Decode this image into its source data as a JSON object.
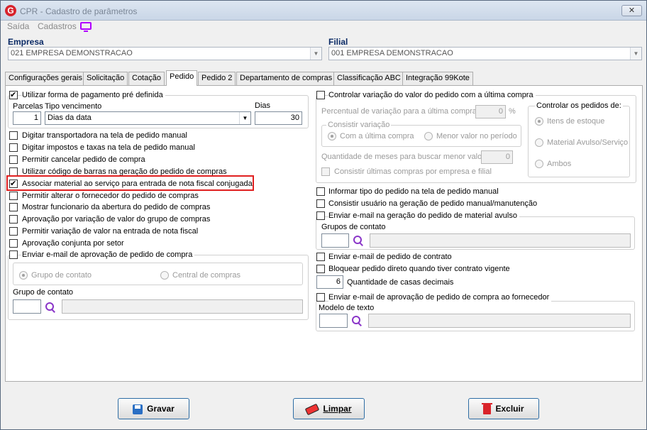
{
  "window": {
    "title": "CPR - Cadastro de parâmetros",
    "close_glyph": "✕",
    "logo_letter": "G"
  },
  "menu": {
    "items": [
      "Saída",
      "Cadastros"
    ],
    "icon": "monitor-icon"
  },
  "empresa": {
    "label": "Empresa",
    "value": "021 EMPRESA DEMONSTRACAO"
  },
  "filial": {
    "label": "Filial",
    "value": "001 EMPRESA DEMONSTRACAO"
  },
  "tabs": [
    "Configurações gerais",
    "Solicitação",
    "Cotação",
    "Pedido",
    "Pedido 2",
    "Departamento de compras",
    "Classificação ABC",
    "Integração 99Kote"
  ],
  "active_tab": "Pedido",
  "left": {
    "pagamento": {
      "label": "Utilizar forma de pagamento pré definida",
      "checked": true,
      "parcelas_label": "Parcelas",
      "parcelas_value": "1",
      "tipo_label": "Tipo vencimento",
      "tipo_value": "Dias da data",
      "dias_label": "Dias",
      "dias_value": "30"
    },
    "options": [
      {
        "label": "Digitar transportadora na tela de pedido manual",
        "checked": false
      },
      {
        "label": "Digitar impostos e taxas na tela de pedido manual",
        "checked": false
      },
      {
        "label": "Permitir cancelar pedido de compra",
        "checked": false
      },
      {
        "label": "Utilizar código de barras na geração do pedido de compras",
        "checked": false
      },
      {
        "label": "Associar material ao serviço para entrada de nota fiscal conjugada",
        "checked": true
      },
      {
        "label": "Permitir alterar o fornecedor do pedido de compras",
        "checked": false
      },
      {
        "label": "Mostrar funcionario da abertura do pedido de compras",
        "checked": false
      },
      {
        "label": "Aprovação por variação de valor do grupo de compras",
        "checked": false
      },
      {
        "label": "Permitir variação de valor na entrada de nota fiscal",
        "checked": false
      },
      {
        "label": "Aprovação conjunta por setor",
        "checked": false
      }
    ],
    "email_aprov": {
      "label": "Enviar e-mail de aprovação de pedido de compra",
      "checked": false,
      "radio_grupo": "Grupo de contato",
      "radio_central": "Central de compras",
      "grupo_label": "Grupo de contato"
    }
  },
  "right": {
    "variacao": {
      "label": "Controlar variação do valor do pedido com a última compra",
      "checked": false,
      "percentual_label": "Percentual de variação para a última compra",
      "percentual_value": "0",
      "percent_sign": "%",
      "consistir_label": "Consistir variação",
      "radio_ultima": "Com a última compra",
      "radio_menor": "Menor valor no período",
      "meses_label": "Quantidade de meses para buscar menor valor",
      "meses_value": "0",
      "consistir_ultimas": "Consistir últimas compras por empresa e filial",
      "controlar_label": "Controlar os pedidos de:",
      "radio_itens": "Itens de estoque",
      "radio_material": "Material Avulso/Serviço",
      "radio_ambos": "Ambos"
    },
    "informar_tipo": {
      "label": "Informar tipo do pedido na tela de pedido manual",
      "checked": false
    },
    "consistir_usuario": {
      "label": "Consistir usuário na geração de pedido manual/manutenção",
      "checked": false
    },
    "email_avulso": {
      "label": "Enviar e-mail na geração do pedido de material avulso",
      "checked": false,
      "grupos_label": "Grupos de contato"
    },
    "email_contrato": {
      "label": "Enviar e-mail de pedido de contrato",
      "checked": false
    },
    "bloquear": {
      "label": "Bloquear pedido direto quando tiver contrato vigente",
      "checked": false
    },
    "casas": {
      "value": "6",
      "label": "Quantidade de casas decimais"
    },
    "email_fornecedor": {
      "label": "Enviar e-mail de aprovação de pedido de compra ao fornecedor",
      "checked": false,
      "modelo_label": "Modelo de texto"
    }
  },
  "buttons": {
    "gravar": "Gravar",
    "limpar": "Limpar",
    "excluir": "Excluir"
  }
}
